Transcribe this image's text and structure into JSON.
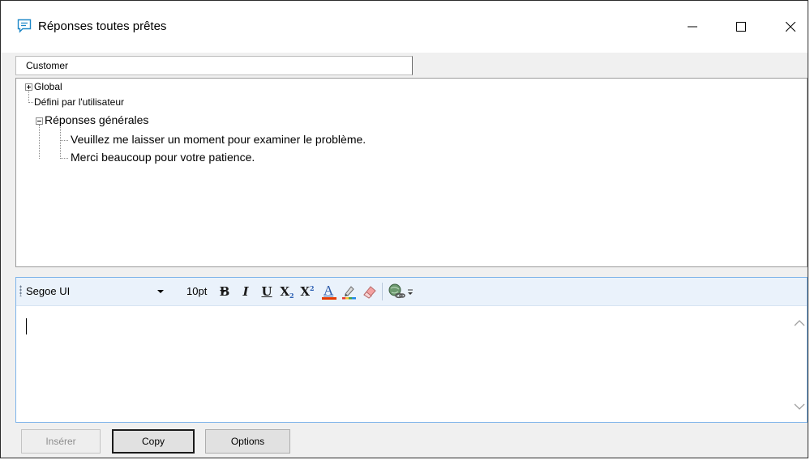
{
  "window": {
    "title": "Réponses toutes prêtes",
    "controls": [
      "minimize-icon",
      "maximize-icon",
      "close-icon"
    ]
  },
  "tree": {
    "column_header": "Customer",
    "nodes": [
      {
        "label": "Global",
        "expander": "plus"
      },
      {
        "label": "Défini par l'utilisateur"
      },
      {
        "label": "Réponses générales",
        "expander": "minus"
      },
      {
        "label": "Veuillez me laisser un moment pour examiner le problème."
      },
      {
        "label": "Merci beaucoup pour votre patience."
      }
    ]
  },
  "editor": {
    "font": "Segoe UI",
    "size": "10pt",
    "tools": [
      {
        "name": "bold-icon",
        "glyph": "B"
      },
      {
        "name": "italic-icon",
        "glyph": "I"
      },
      {
        "name": "underline-icon",
        "glyph": "U"
      },
      {
        "name": "subscript-icon",
        "glyph": "X"
      },
      {
        "name": "superscript-icon",
        "glyph": "X"
      },
      {
        "name": "font-color-icon",
        "glyph": "A"
      },
      {
        "name": "highlight-icon"
      },
      {
        "name": "eraser-icon"
      },
      {
        "name": "hyperlink-icon"
      },
      {
        "name": "more-options-icon"
      }
    ],
    "content": ""
  },
  "buttons": {
    "insert": "Insérer",
    "copy": "Copy",
    "options": "Options"
  },
  "colors": {
    "accent": "#1e88c8",
    "font_color_bar": "#e53a00",
    "toolbar_bg": "#eaf2fb"
  }
}
